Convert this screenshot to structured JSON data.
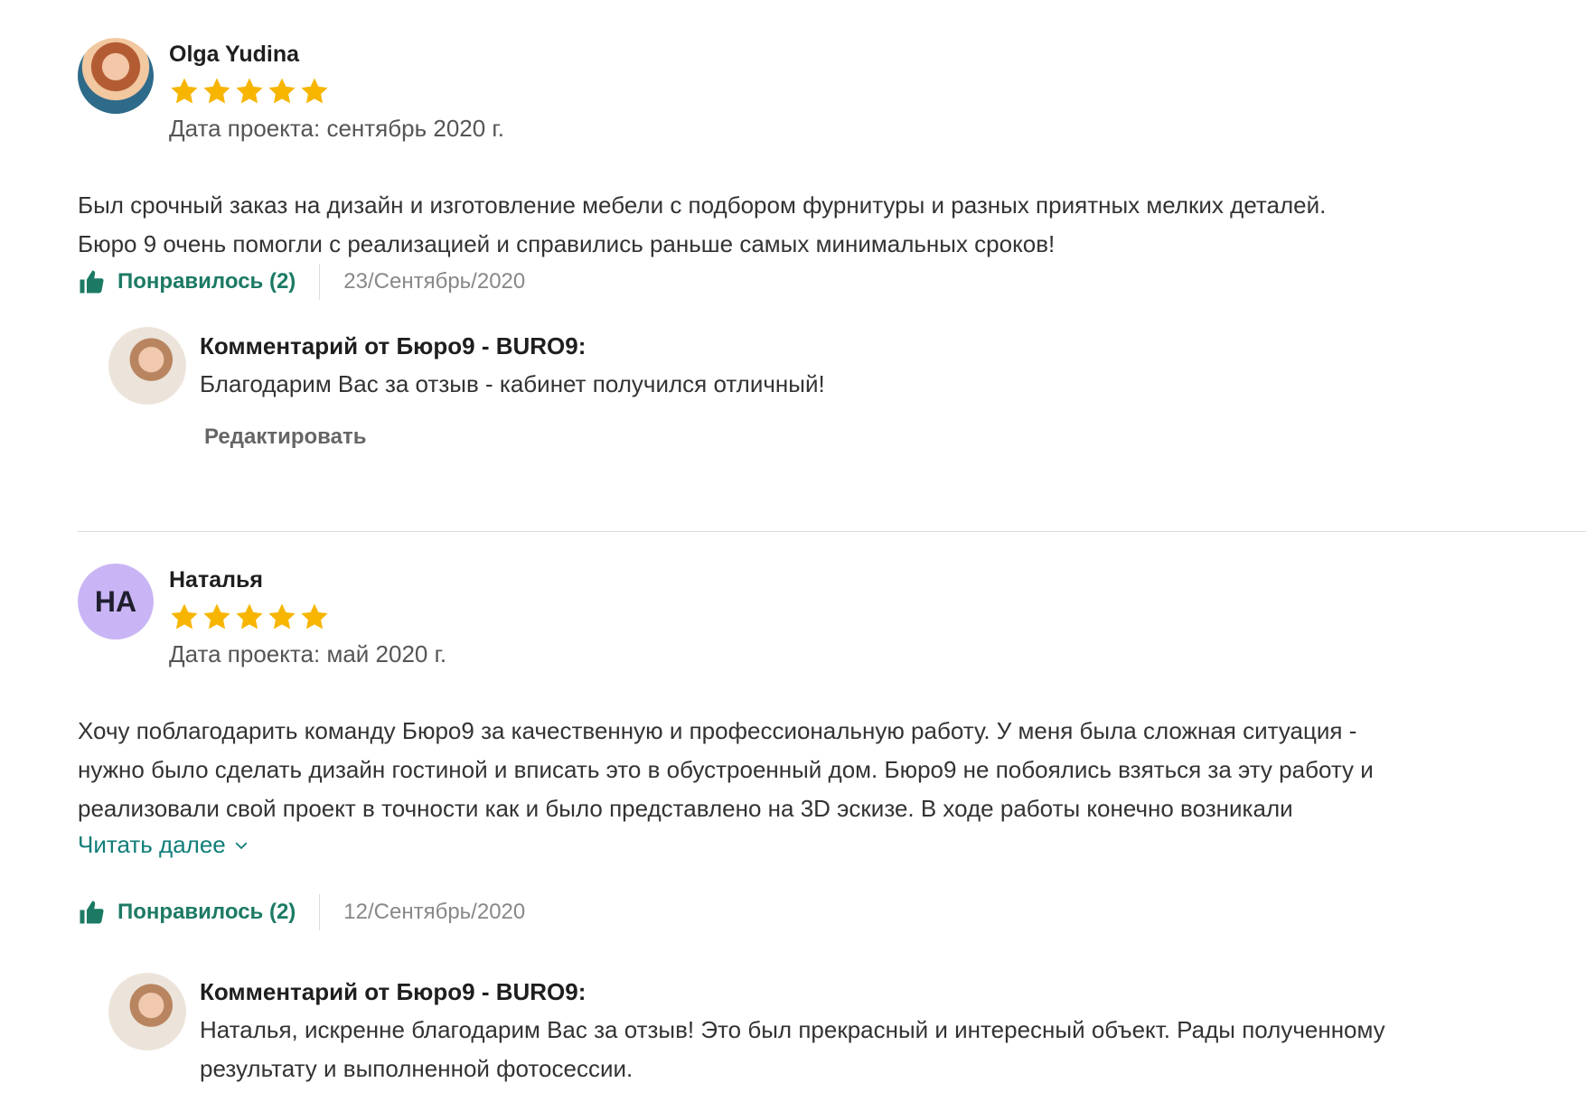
{
  "reviews": [
    {
      "author": "Olga Yudina",
      "avatar": {
        "type": "photo",
        "initials": ""
      },
      "rating": 5,
      "project_date": "Дата проекта: сентябрь 2020 г.",
      "text_lines": [
        "Был срочный заказ на дизайн и изготовление мебели с подбором фурнитуры и разных приятных мелких деталей.",
        "Бюро 9 очень помогли с реализацией и справились раньше самых минимальных сроков!"
      ],
      "like_label": "Понравилось (2)",
      "published": "23/Сентябрь/2020",
      "reply": {
        "title": "Комментарий от Бюро9 - BURO9:",
        "text_lines": [
          "Благодарим Вас за отзыв - кабинет получился отличный!"
        ],
        "edit_label": "Редактировать"
      }
    },
    {
      "author": "Наталья",
      "avatar": {
        "type": "initials",
        "initials": "НА",
        "color": "#c9b5f5"
      },
      "rating": 5,
      "project_date": "Дата проекта: май 2020 г.",
      "text_lines": [
        "Хочу поблагодарить команду Бюро9 за качественную и профессиональную работу. У меня была сложная ситуация -",
        "нужно было сделать дизайн гостиной и вписать это в обустроенный дом. Бюро9 не побоялись взяться за эту работу и",
        "реализовали свой проект в точности как и было представлено на 3D эскизе. В ходе работы конечно возникали"
      ],
      "read_more_label": "Читать далее",
      "like_label": "Понравилось (2)",
      "published": "12/Сентябрь/2020",
      "reply": {
        "title": "Комментарий от Бюро9 - BURO9:",
        "text_lines": [
          "Наталья, искренне благодарим Вас за отзыв! Это был прекрасный и интересный объект. Рады полученному",
          "результату и выполненной фотосессии."
        ]
      }
    }
  ],
  "colors": {
    "star": "#f7b500",
    "like": "#1c7a64",
    "link": "#0f7d78",
    "avatar_initials_bg": "#c9b5f5"
  },
  "icons": {
    "rating": "star-icon",
    "like": "thumbs-up-icon",
    "read_more": "chevron-down-icon"
  }
}
